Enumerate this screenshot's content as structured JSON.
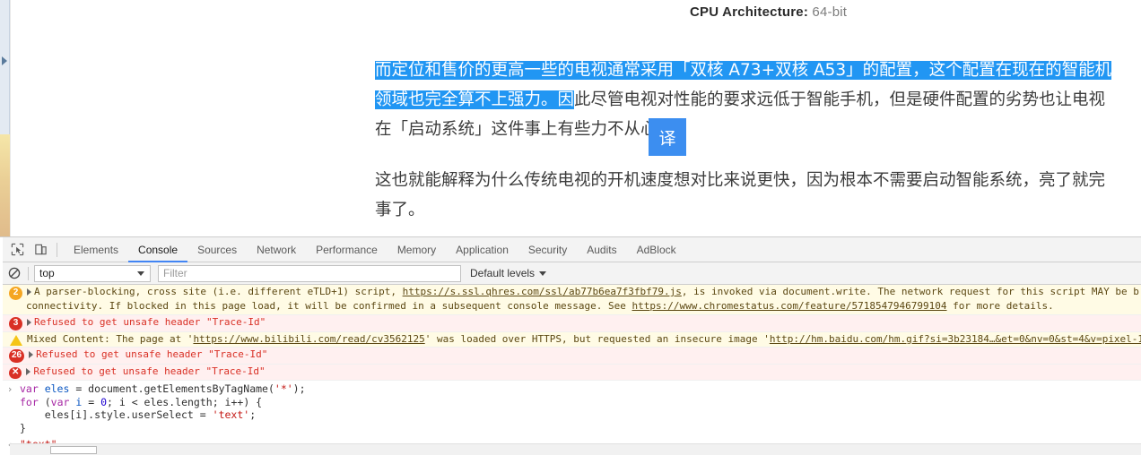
{
  "page": {
    "cpu_label": "CPU Architecture:",
    "cpu_value": " 64-bit",
    "paragraph1": {
      "selected_part1": "而定位和售价的更高一些的电视通常采用「双核 A73+双核 A53」的配置，这个配置在现在的",
      "selected_part2": "智能机领域也完全算不上强力。因",
      "unselected_rest": "此尽管电视对性能的要求远低于智能手机，但是硬件配置的劣势也让电视在「启动系统」这件事上有些力不从心。"
    },
    "paragraph2": "这也就能解释为什么传统电视的开机速度想对比来说更快，因为根本不需要启动智能系统，亮了就完事了。",
    "translate_button": "译"
  },
  "devtools": {
    "tabs": [
      {
        "label": "Elements",
        "active": false
      },
      {
        "label": "Console",
        "active": true
      },
      {
        "label": "Sources",
        "active": false
      },
      {
        "label": "Network",
        "active": false
      },
      {
        "label": "Performance",
        "active": false
      },
      {
        "label": "Memory",
        "active": false
      },
      {
        "label": "Application",
        "active": false
      },
      {
        "label": "Security",
        "active": false
      },
      {
        "label": "Audits",
        "active": false
      },
      {
        "label": "AdBlock",
        "active": false
      }
    ],
    "filterbar": {
      "context": "top",
      "filter_value": "",
      "filter_placeholder": "Filter",
      "levels": "Default levels"
    },
    "messages": [
      {
        "type": "warning",
        "count": "2",
        "line1_a": "A parser-blocking, cross site (i.e. different eTLD+1) script, ",
        "line1_link": "https://s.ssl.qhres.com/ssl/ab77b6ea7f3fbf79.js",
        "line1_b": ", is invoked via document.write. The network request for this script MAY be b",
        "line2_a": "connectivity. If blocked in this page load, it will be confirmed in a subsequent console message. See ",
        "line2_link": "https://www.chromestatus.com/feature/5718547946799104",
        "line2_b": " for more details."
      },
      {
        "type": "error",
        "count": "3",
        "line1_a": "Refused to get unsafe header \"Trace-Id\""
      },
      {
        "type": "warning",
        "count": "",
        "line1_a": "Mixed Content: The page at '",
        "line1_link": "https://www.bilibili.com/read/cv3562125",
        "line1_b": "' was loaded over HTTPS, but requested an insecure image '",
        "line1_link2": "http://hm.baidu.com/hm.gif?si=3b23184…&et=0&nv=0&st=4&v=pixel-1"
      },
      {
        "type": "error",
        "count": "26",
        "line1_a": "Refused to get unsafe header \"Trace-Id\""
      },
      {
        "type": "error",
        "count": "x",
        "line1_a": "Refused to get unsafe header \"Trace-Id\""
      }
    ],
    "console_input": {
      "prompt": "›",
      "line1_kw": "var",
      "line1_var": " eles ",
      "line1_op": "= document.getElementsByTagName(",
      "line1_str": "'*'",
      "line1_end": ");",
      "line2_kw": "for",
      "line2_a": " (",
      "line2_kw2": "var",
      "line2_var": " i ",
      "line2_b": "= ",
      "line2_num": "0",
      "line2_c": "; i < eles.length; i++) {",
      "line3": "    eles[i].style.userSelect = ",
      "line3_str": "'text'",
      "line3_end": ";",
      "line4": "}"
    },
    "console_output": {
      "prompt": "‹",
      "value": "\"text\""
    }
  }
}
